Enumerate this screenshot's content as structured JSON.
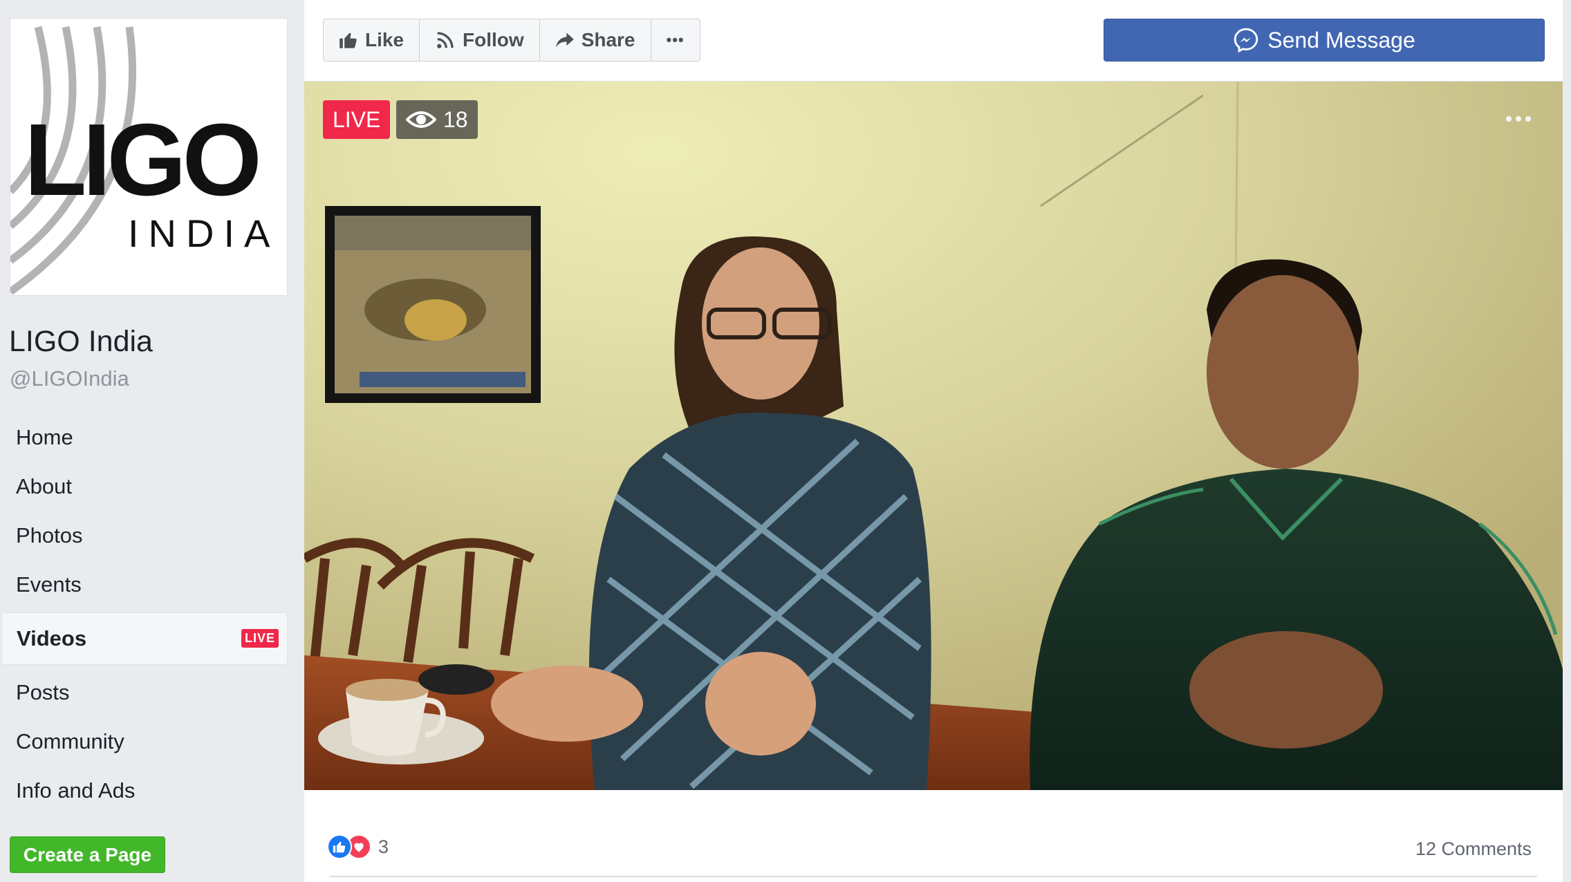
{
  "sidebar": {
    "logo": {
      "main": "LIGO",
      "sub": "INDIA"
    },
    "page_name": "LIGO India",
    "page_handle": "@LIGOIndia",
    "nav": [
      {
        "label": "Home"
      },
      {
        "label": "About"
      },
      {
        "label": "Photos"
      },
      {
        "label": "Events"
      },
      {
        "label": "Videos",
        "active": true,
        "badge": "LIVE"
      },
      {
        "label": "Posts"
      },
      {
        "label": "Community"
      },
      {
        "label": "Info and Ads"
      }
    ],
    "create_page_label": "Create a Page"
  },
  "action_bar": {
    "like_label": "Like",
    "follow_label": "Follow",
    "share_label": "Share",
    "more_label": "•••",
    "send_message_label": "Send Message"
  },
  "video": {
    "live_label": "LIVE",
    "viewer_count": "18"
  },
  "footer": {
    "reaction_count": "3",
    "comments_label": "12 Comments"
  },
  "colors": {
    "brand_blue": "#4267b2",
    "live_red": "#f02849",
    "create_green": "#42b72a",
    "like_blue": "#1877f2",
    "love_red": "#f33e58"
  },
  "icons": [
    "thumbs-up-icon",
    "rss-icon",
    "share-arrow-icon",
    "more-dots-icon",
    "messenger-icon",
    "eye-icon",
    "like-reaction-icon",
    "love-reaction-icon"
  ]
}
